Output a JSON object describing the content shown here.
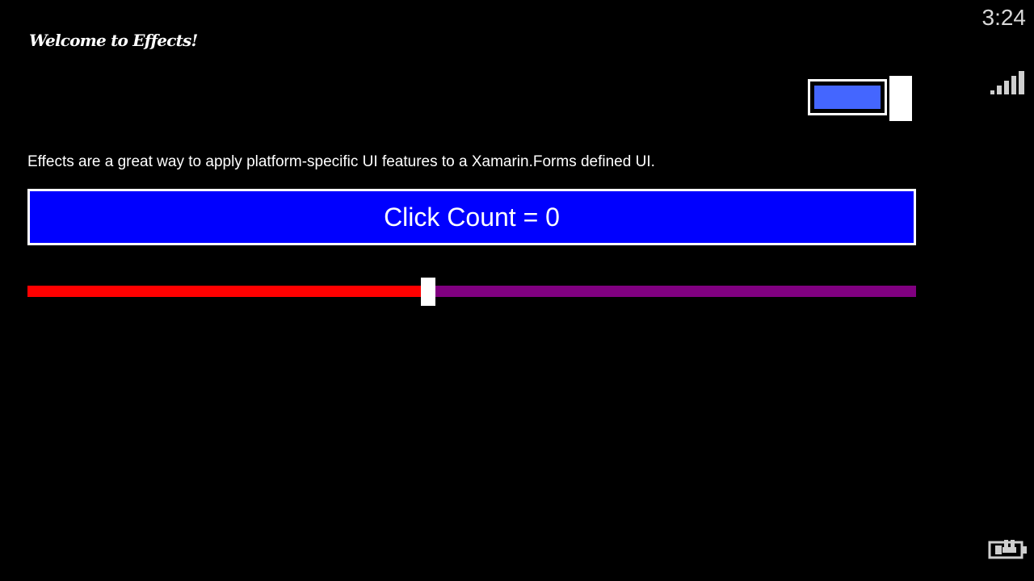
{
  "app": {
    "title": "Welcome to Effects!",
    "description": "Effects are a great way to apply platform-specific UI features to a Xamarin.Forms defined UI."
  },
  "status_bar": {
    "time": "3:24",
    "signal_icon": "signal-strength-icon",
    "battery_icon": "battery-charging-icon"
  },
  "switch": {
    "is_on": true,
    "fill_color": "#4466ff"
  },
  "click_button": {
    "label": "Click Count = 0",
    "background": "#0000ff"
  },
  "slider": {
    "value": 0.45,
    "min_track_color": "#ff0000",
    "max_track_color": "#800080"
  },
  "colors": {
    "background": "#000000",
    "foreground": "#ffffff"
  }
}
